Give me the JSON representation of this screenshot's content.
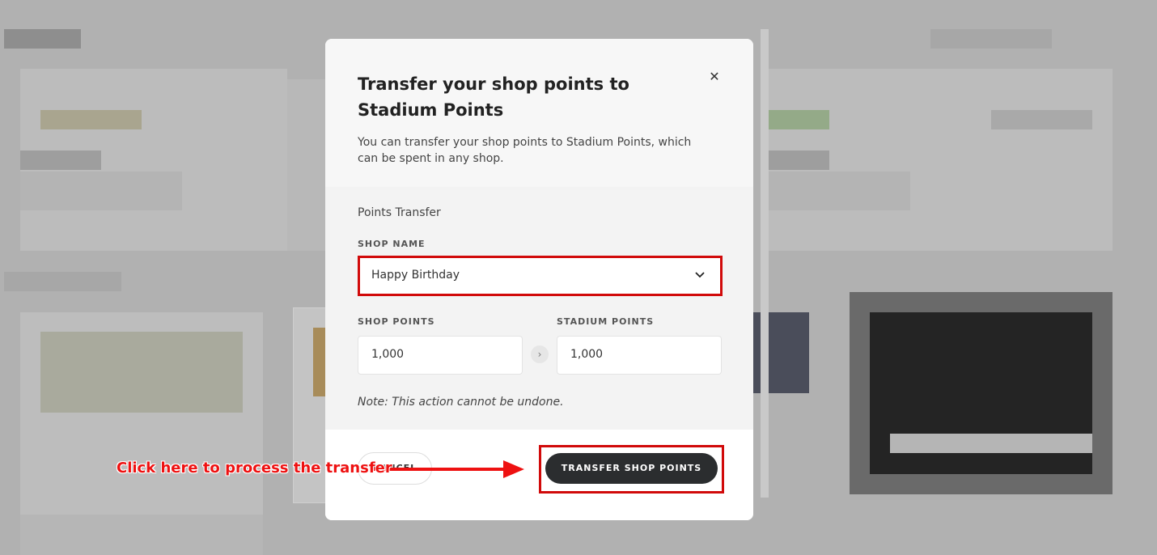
{
  "modal": {
    "title": "Transfer your shop points to Stadium Points",
    "description": "You can transfer your shop points to Stadium Points, which can be spent in any shop.",
    "close_icon": "close-icon",
    "section_title": "Points Transfer",
    "shop_name_label": "SHOP NAME",
    "shop_name_value": "Happy Birthday",
    "shop_points_label": "SHOP POINTS",
    "shop_points_value": "1,000",
    "stadium_points_label": "STADIUM POINTS",
    "stadium_points_value": "1,000",
    "note": "Note: This action cannot be undone.",
    "cancel_label": "CANCEL",
    "transfer_label": "TRANSFER SHOP POINTS"
  },
  "annotation": {
    "text": "Click here to process the transfer",
    "color": "#e11111"
  },
  "colors": {
    "button_dark": "#2b2d2f",
    "highlight": "#d10a0a"
  }
}
